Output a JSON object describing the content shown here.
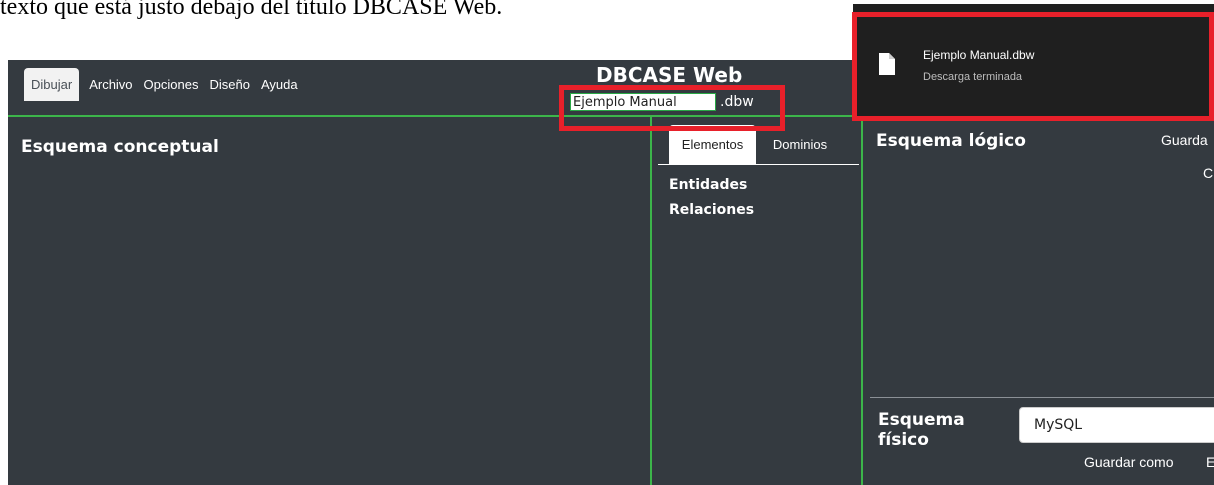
{
  "doc_text": "texto que está justo debajo del título DBCASE Web.",
  "app": {
    "nav": [
      "Dibujar",
      "Archivo",
      "Opciones",
      "Diseño",
      "Ayuda"
    ],
    "active_nav": "Dibujar",
    "title": "DBCASE Web",
    "filename_value": "Ejemplo Manual",
    "extension": ".dbw"
  },
  "conceptual": {
    "title": "Esquema conceptual"
  },
  "elements_panel": {
    "tabs": [
      "Elementos",
      "Dominios"
    ],
    "active_tab": "Elementos",
    "items": [
      "Entidades",
      "Relaciones"
    ]
  },
  "logical": {
    "title": "Esquema lógico",
    "save_label": "Guarda",
    "partial_letter": "C"
  },
  "physical": {
    "title": "Esquema físico",
    "db_selected": "MySQL",
    "save_as": "Guardar como",
    "partial_letter": "E"
  },
  "download": {
    "file_name": "Ejemplo Manual.dbw",
    "status": "Descarga terminada"
  },
  "colors": {
    "app_bg": "#343a40",
    "accent_green": "#3cb54a",
    "highlight_red": "#e8202a",
    "download_bg": "#1f1f1f"
  }
}
